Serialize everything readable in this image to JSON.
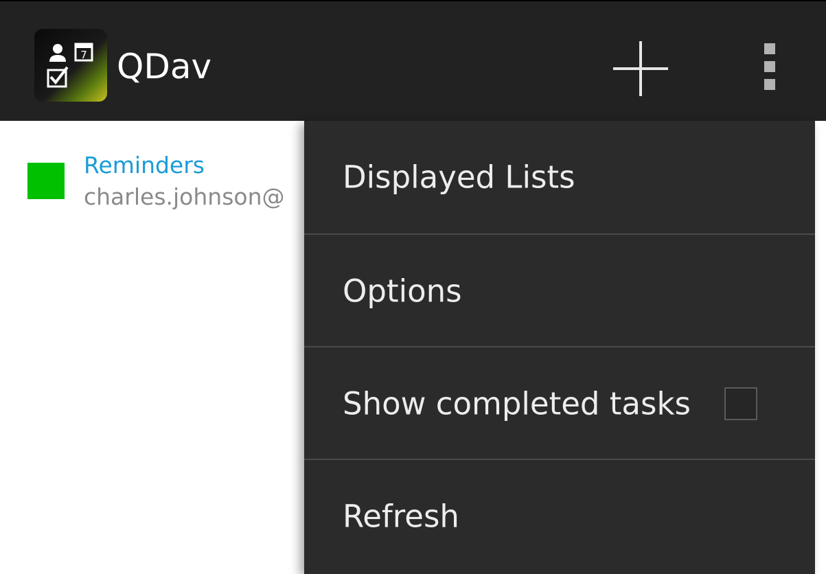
{
  "app": {
    "title": "QDav"
  },
  "action_bar": {
    "add_icon": "plus-icon",
    "overflow_icon": "overflow-menu-icon",
    "background_color": "#222222"
  },
  "lists": [
    {
      "name": "Reminders",
      "account": "charles.johnson@",
      "color": "#00c000",
      "name_color": "#1a9bd7"
    }
  ],
  "menu": {
    "items": [
      {
        "label": "Displayed Lists"
      },
      {
        "label": "Options"
      },
      {
        "label": "Show completed tasks",
        "checked": false
      },
      {
        "label": "Refresh"
      }
    ]
  }
}
